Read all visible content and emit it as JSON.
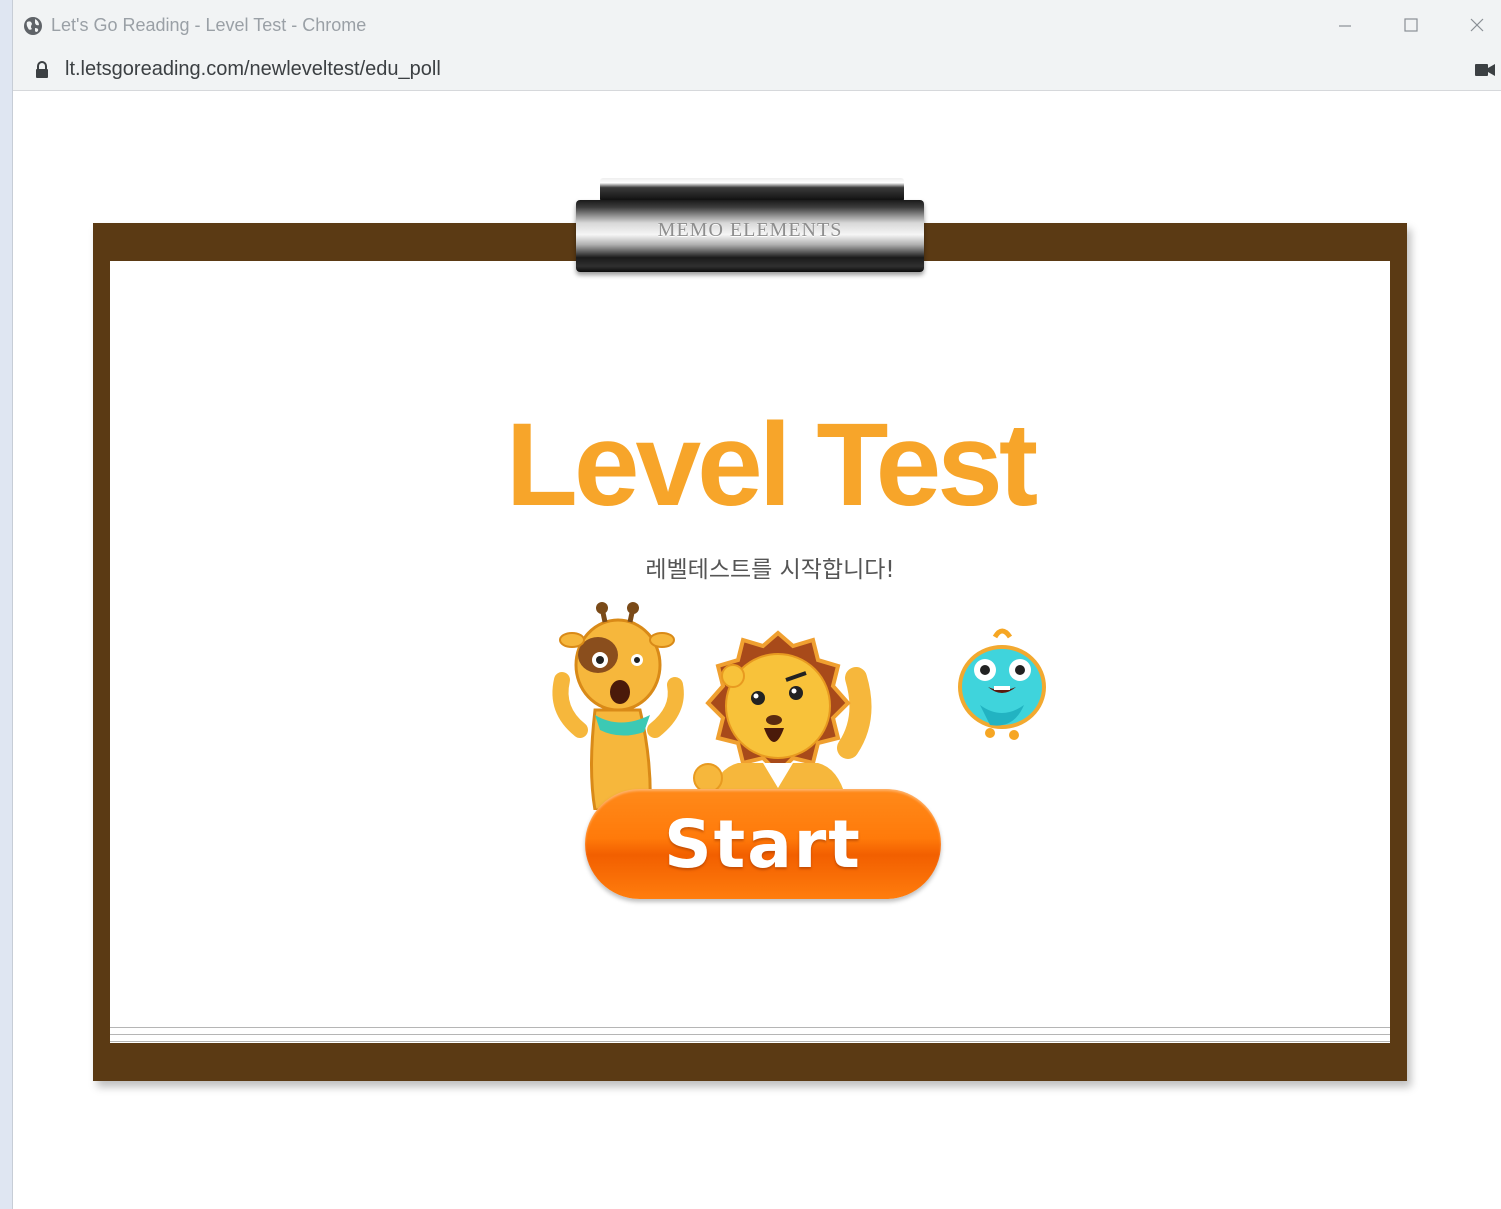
{
  "browser": {
    "window_title": "Let's Go Reading - Level Test - Chrome",
    "url": "lt.letsgoreading.com/newleveltest/edu_poll"
  },
  "clipboard": {
    "clip_label": "MEMO ELEMENTS"
  },
  "main": {
    "heading": "Level Test",
    "subtitle": "레벨테스트를 시작합니다!",
    "start_label": "Start"
  },
  "colors": {
    "heading": "#f7a52a",
    "board": "#5b3a14",
    "start_button": "#ff7a0a"
  },
  "icons": {
    "titlebar": "globe-icon",
    "address": "lock-icon",
    "camera": "camera-icon",
    "mascots": [
      "giraffe-mascot",
      "lion-mascot",
      "owl-mascot"
    ]
  }
}
